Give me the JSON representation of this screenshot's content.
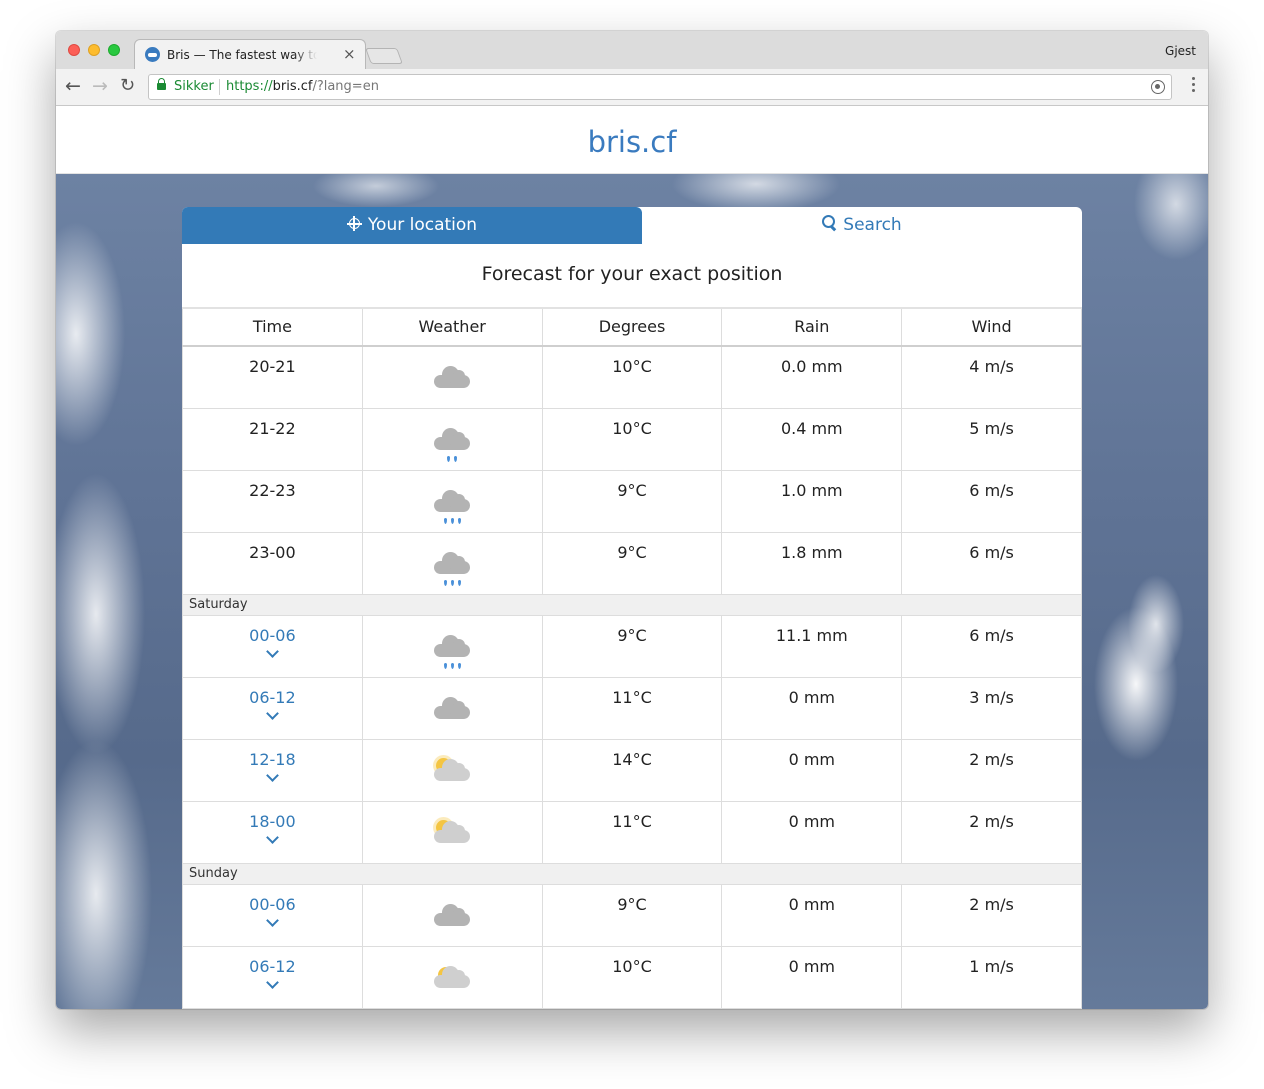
{
  "browser": {
    "tab_title": "Bris — The fastest way to check the weather",
    "tab_close": "×",
    "user_label": "Gjest",
    "secure_label": "Sikker",
    "url_scheme": "https://",
    "url_host": "bris.cf",
    "url_query": "/?lang=en",
    "nav_back": "←",
    "nav_forward": "→",
    "nav_reload": "↻"
  },
  "site": {
    "brand": "bris.cf"
  },
  "tabs": {
    "location_label": "Your location",
    "search_label": "Search"
  },
  "forecast": {
    "heading": "Forecast for your exact position",
    "columns": [
      "Time",
      "Weather",
      "Degrees",
      "Rain",
      "Wind"
    ],
    "hourly": [
      {
        "time": "20-21",
        "icon": "cloudy-icon",
        "degrees": "10°C",
        "rain": "0.0 mm",
        "wind": "4 m/s"
      },
      {
        "time": "21-22",
        "icon": "light-rain-icon",
        "degrees": "10°C",
        "rain": "0.4 mm",
        "wind": "5 m/s"
      },
      {
        "time": "22-23",
        "icon": "rain-icon",
        "degrees": "9°C",
        "rain": "1.0 mm",
        "wind": "6 m/s"
      },
      {
        "time": "23-00",
        "icon": "rain-icon",
        "degrees": "9°C",
        "rain": "1.8 mm",
        "wind": "6 m/s"
      }
    ],
    "days": [
      {
        "label": "Saturday",
        "rows": [
          {
            "time": "00-06",
            "icon": "rain-icon",
            "degrees": "9°C",
            "rain": "11.1 mm",
            "wind": "6 m/s"
          },
          {
            "time": "06-12",
            "icon": "cloudy-icon",
            "degrees": "11°C",
            "rain": "0 mm",
            "wind": "3 m/s"
          },
          {
            "time": "12-18",
            "icon": "partly-sunny-icon",
            "degrees": "14°C",
            "rain": "0 mm",
            "wind": "2 m/s"
          },
          {
            "time": "18-00",
            "icon": "partly-sunny-icon",
            "degrees": "11°C",
            "rain": "0 mm",
            "wind": "2 m/s"
          }
        ]
      },
      {
        "label": "Sunday",
        "rows": [
          {
            "time": "00-06",
            "icon": "cloudy-icon",
            "degrees": "9°C",
            "rain": "0 mm",
            "wind": "2 m/s"
          },
          {
            "time": "06-12",
            "icon": "partly-cloudy-icon",
            "degrees": "10°C",
            "rain": "0 mm",
            "wind": "1 m/s"
          }
        ]
      }
    ]
  },
  "colors": {
    "brand": "#337ab7",
    "secure": "#1a8a33"
  }
}
